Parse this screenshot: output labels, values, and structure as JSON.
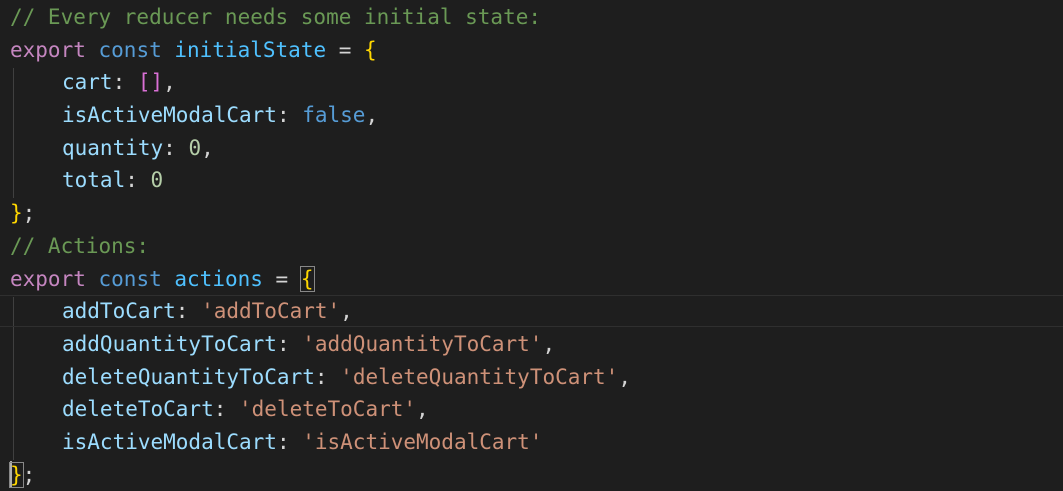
{
  "theme": {
    "background": "#1e1e1e",
    "comment": "#6a9955",
    "keyword": "#c586c0",
    "storage": "#569cd6",
    "constant": "#4fc1ff",
    "property": "#9cdcfe",
    "brace": "#ffd700",
    "bracket": "#da70d6",
    "number": "#b5cea8",
    "string": "#ce9178"
  },
  "code": {
    "l1_comment": "// Every reducer needs some initial state:",
    "l2_export": "export",
    "l2_const": "const",
    "l2_name": "initialState",
    "l2_eq": " = ",
    "l2_brace": "{",
    "l3_key": "cart",
    "l3_colon": ": ",
    "l3_value": "[]",
    "l3_comma": ",",
    "l4_key": "isActiveModalCart",
    "l4_colon": ": ",
    "l4_value": "false",
    "l4_comma": ",",
    "l5_key": "quantity",
    "l5_colon": ": ",
    "l5_value": "0",
    "l5_comma": ",",
    "l6_key": "total",
    "l6_colon": ": ",
    "l6_value": "0",
    "l7_brace": "}",
    "l7_semi": ";",
    "l8_comment": "// Actions:",
    "l9_export": "export",
    "l9_const": "const",
    "l9_name": "actions",
    "l9_eq": " = ",
    "l9_brace": "{",
    "l10_key": "addToCart",
    "l10_colon": ": ",
    "l10_value": "'addToCart'",
    "l10_comma": ",",
    "l11_key": "addQuantityToCart",
    "l11_colon": ": ",
    "l11_value": "'addQuantityToCart'",
    "l11_comma": ",",
    "l12_key": "deleteQuantityToCart",
    "l12_colon": ": ",
    "l12_value": "'deleteQuantityToCart'",
    "l12_comma": ",",
    "l13_key": "deleteToCart",
    "l13_colon": ": ",
    "l13_value": "'deleteToCart'",
    "l13_comma": ",",
    "l14_key": "isActiveModalCart",
    "l14_colon": ": ",
    "l14_value": "'isActiveModalCart'",
    "l15_brace": "}",
    "l15_semi": ";"
  }
}
